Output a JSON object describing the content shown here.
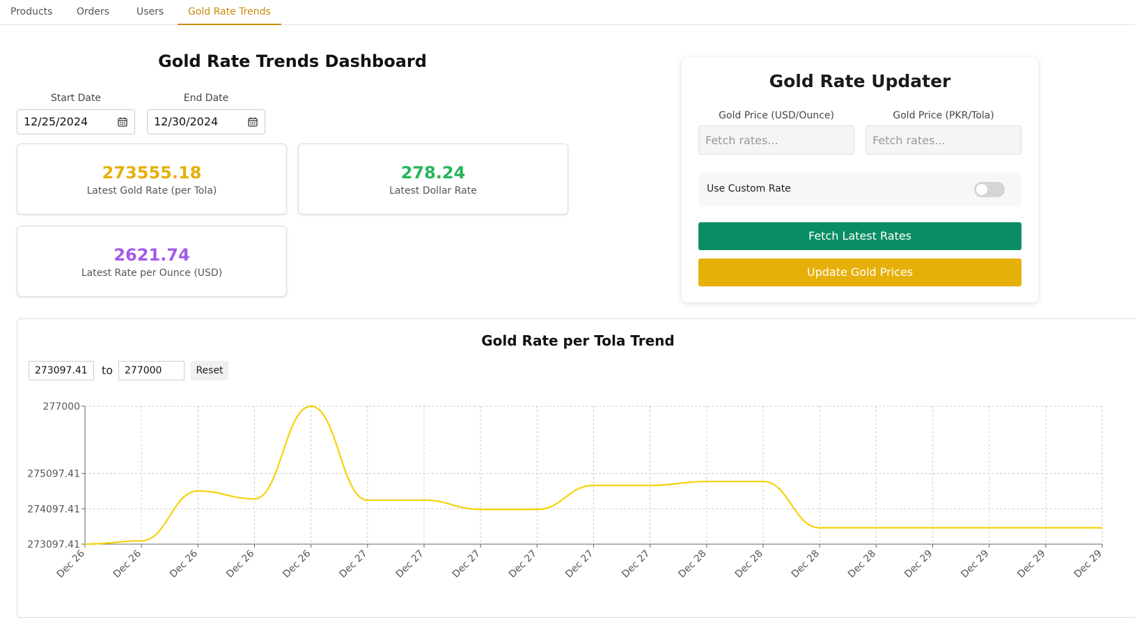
{
  "nav": {
    "tabs": [
      {
        "label": "Products"
      },
      {
        "label": "Orders"
      },
      {
        "label": "Users"
      },
      {
        "label": "Gold Rate Trends"
      }
    ],
    "active": "Gold Rate Trends"
  },
  "dashboard": {
    "title": "Gold Rate Trends Dashboard",
    "start_date_label": "Start Date",
    "start_date_value": "12/25/2024",
    "end_date_label": "End Date",
    "end_date_value": "12/30/2024",
    "stats": [
      {
        "value": "273555.18",
        "label": "Latest Gold Rate (per Tola)",
        "color": "#e6b00a"
      },
      {
        "value": "278.24",
        "label": "Latest Dollar Rate",
        "color": "#27b35a"
      },
      {
        "value": "2621.74",
        "label": "Latest Rate per Ounce (USD)",
        "color": "#a35ae6"
      }
    ]
  },
  "updater": {
    "title": "Gold Rate Updater",
    "usd_label": "Gold Price (USD/Ounce)",
    "usd_placeholder": "Fetch rates...",
    "pkr_label": "Gold Price (PKR/Tola)",
    "pkr_placeholder": "Fetch rates...",
    "custom_rate_label": "Use Custom Rate",
    "custom_rate_enabled": false,
    "fetch_button": "Fetch Latest Rates",
    "update_button": "Update Gold Prices",
    "fetch_color": "#0a8d64",
    "update_color": "#e6b00a"
  },
  "chart_panel": {
    "range_from": "273097.41",
    "range_to_label": "to",
    "range_to": "277000",
    "reset_label": "Reset"
  },
  "chart_data": {
    "type": "line",
    "title": "Gold Rate per Tola Trend",
    "xlabel": "",
    "ylabel": "",
    "ylim": [
      273097.41,
      277000
    ],
    "y_ticks": [
      273097.41,
      274097.41,
      275097.41,
      277000
    ],
    "y_tick_labels": [
      "273097.41",
      "274097.41",
      "275097.41",
      "277000"
    ],
    "categories": [
      "Dec 26",
      "Dec 26",
      "Dec 26",
      "Dec 26",
      "Dec 26",
      "Dec 27",
      "Dec 27",
      "Dec 27",
      "Dec 27",
      "Dec 27",
      "Dec 27",
      "Dec 28",
      "Dec 28",
      "Dec 28",
      "Dec 28",
      "Dec 29",
      "Dec 29",
      "Dec 29",
      "Dec 29"
    ],
    "series": [
      {
        "values": [
          273097.41,
          273190,
          274600,
          274380,
          277000,
          274340,
          274340,
          274080,
          274080,
          274760,
          274760,
          274870,
          274870,
          273560,
          273560,
          273560,
          273560,
          273560,
          273560
        ],
        "color": "#f5d20a"
      }
    ],
    "grid": true,
    "legend": "none"
  }
}
